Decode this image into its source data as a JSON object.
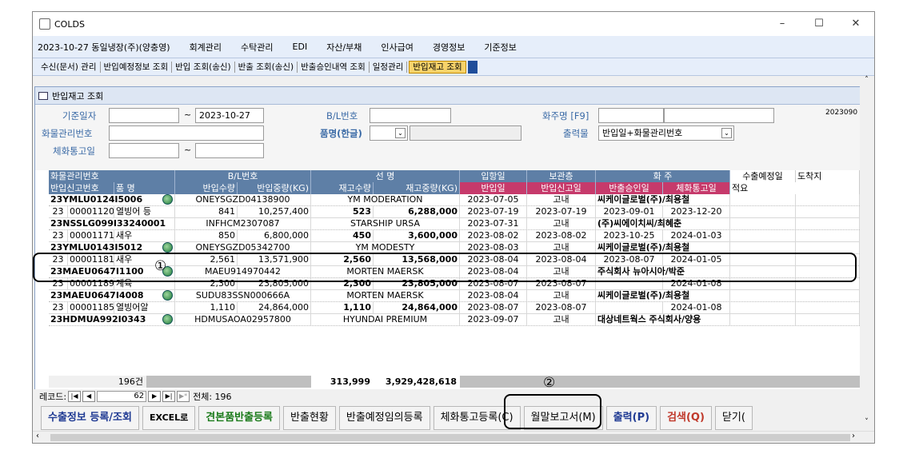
{
  "app": {
    "title": "COLDS"
  },
  "window": {
    "minimize": "–",
    "maximize": "☐",
    "close": "✕"
  },
  "menu": [
    "2023-10-27 동일냉장(주)(양충영)",
    "회계관리",
    "수탁관리",
    "EDI",
    "자산/부채",
    "인사급여",
    "경영정보",
    "기준정보"
  ],
  "toolbar": [
    "수신(문서) 관리",
    "반입예정정보 조회",
    "반입 조회(송신)",
    "반출 조회(송신)",
    "반출승인내역 조회",
    "일정관리",
    "반입재고 조회"
  ],
  "subwindow": {
    "title": "반입재고 조회"
  },
  "filters": {
    "base_date_label": "기준일자",
    "base_date_from": "",
    "tilde": "~",
    "base_date_to": "2023-10-27",
    "bl_label": "B/L번호",
    "bl_value": "",
    "shipper_label": "화주명 [F9]",
    "shipper_value": "",
    "shipper_value2": "",
    "cargo_label": "화물관리번호",
    "cargo_value": "",
    "product_label": "품명(한글)",
    "product_value": "",
    "output_label": "출력물",
    "output_value": "반입일+화물관리번호",
    "clear_label": "체화통고일",
    "clear_from": "",
    "clear_to": "",
    "corner_text": "2023090"
  },
  "headers": {
    "row1": [
      "화물관리번호",
      "B/L번호",
      "선  명",
      "입항일",
      "보관층",
      "화  주",
      "수출예정일",
      "도착지"
    ],
    "row2": [
      "반입신고번호",
      "품  명",
      "반입수량",
      "반입중량(KG)",
      "재고수량",
      "재고중량(KG)",
      "반입일",
      "반입신고일",
      "반출승인일",
      "체화통고일",
      "적요"
    ]
  },
  "rows": [
    {
      "cargo": "23YMLU0124I5006",
      "bl": "ONEYSGZD04138900",
      "vessel": "YM MODERATION",
      "arrival": "2023-07-05",
      "floor": "고내",
      "shipper": "씨케이글로벌(주)/최용철",
      "seq": "23",
      "rptno": "00001120",
      "item": "열빙어 등",
      "inqty": "841",
      "inwt": "10,257,400",
      "stqty": "523",
      "stwt": "6,288,000",
      "indate": "2023-07-19",
      "rptdate": "2023-07-19",
      "outdate": "2023-09-01",
      "notice": "2023-12-20"
    },
    {
      "cargo": "23NSSLG099I33240001",
      "bl": "INFHCM2307087",
      "vessel": "STARSHIP URSA",
      "arrival": "2023-07-31",
      "floor": "고내",
      "shipper": "(주)씨에이치씨/최혜춘",
      "seq": "23",
      "rptno": "00001171",
      "item": "새우",
      "inqty": "850",
      "inwt": "6,800,000",
      "stqty": "450",
      "stwt": "3,600,000",
      "indate": "2023-08-02",
      "rptdate": "2023-08-02",
      "outdate": "2023-10-25",
      "notice": "2024-01-03"
    },
    {
      "cargo": "23YMLU0143I5012",
      "bl": "ONEYSGZD05342700",
      "vessel": "YM MODESTY",
      "arrival": "2023-08-03",
      "floor": "고내",
      "shipper": "씨케이글로벌(주)/최용철",
      "seq": "23",
      "rptno": "00001181",
      "item": "새우",
      "inqty": "2,561",
      "inwt": "13,571,900",
      "stqty": "2,560",
      "stwt": "13,568,000",
      "indate": "2023-08-04",
      "rptdate": "2023-08-04",
      "outdate": "2023-08-07",
      "notice": "2024-01-05"
    },
    {
      "cargo": "23MAEU0647I1100",
      "bl": "MAEU914970442",
      "vessel": "MORTEN MAERSK",
      "arrival": "2023-08-04",
      "floor": "고내",
      "shipper": "주식회사 뉴아시아/박준",
      "seq": "23",
      "rptno": "00001189",
      "item": "계육",
      "inqty": "2,300",
      "inwt": "23,805,000",
      "stqty": "2,300",
      "stwt": "23,805,000",
      "indate": "2023-08-07",
      "rptdate": "2023-08-07",
      "outdate": "",
      "notice": "2024-01-08"
    },
    {
      "cargo": "23MAEU0647I4008",
      "bl": "SUDU83SSN000666A",
      "vessel": "MORTEN MAERSK",
      "arrival": "2023-08-04",
      "floor": "고내",
      "shipper": "씨케이글로벌(주)/최용철",
      "seq": "23",
      "rptno": "00001185",
      "item": "열빙어알",
      "inqty": "1,110",
      "inwt": "24,864,000",
      "stqty": "1,110",
      "stwt": "24,864,000",
      "indate": "2023-08-07",
      "rptdate": "2023-08-07",
      "outdate": "",
      "notice": "2024-01-08"
    },
    {
      "cargo": "23HDMUA992I0343",
      "bl": "HDMUSAOA02957800",
      "vessel": "HYUNDAI PREMIUM",
      "arrival": "2023-09-07",
      "floor": "고내",
      "shipper": "대상네트웍스 주식회사/양용"
    }
  ],
  "totals": {
    "count": "196건",
    "stqty": "313,999",
    "stwt": "3,929,428,618"
  },
  "recnav": {
    "label": "레코드:",
    "current": "62",
    "total_label": "전체: 196"
  },
  "buttons": [
    {
      "label": "수출정보 등록/조회",
      "color": "#1f3a93"
    },
    {
      "label": "EXCEL로",
      "color": "#000"
    },
    {
      "label": "견본품반출등록",
      "color": "#1a7a1a"
    },
    {
      "label": "반출현황",
      "color": "#000"
    },
    {
      "label": "반출예정임의등록",
      "color": "#000"
    },
    {
      "label": "체화통고등록(C)",
      "color": "#000"
    },
    {
      "label": "월말보고서(M)",
      "color": "#000"
    },
    {
      "label": "출력(P)",
      "color": "#1f3a93"
    },
    {
      "label": "검색(Q)",
      "color": "#c0392b"
    },
    {
      "label": "닫기(",
      "color": "#000"
    }
  ],
  "annotations": {
    "mark1": "①",
    "mark2": "②"
  }
}
